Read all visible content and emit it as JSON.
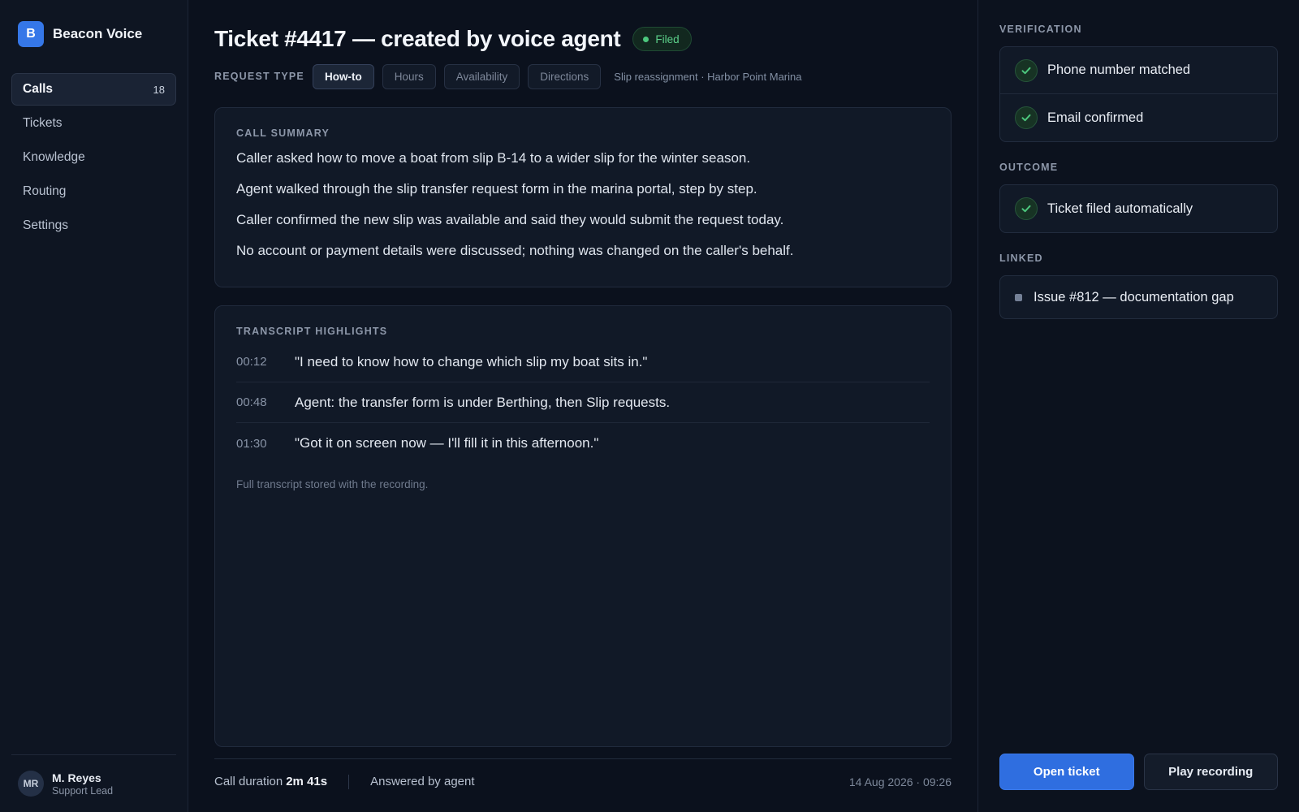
{
  "brand": {
    "logo_letter": "B",
    "name": "Beacon Voice"
  },
  "nav": {
    "items": [
      {
        "label": "Calls",
        "count": "18"
      },
      {
        "label": "Tickets"
      },
      {
        "label": "Knowledge"
      },
      {
        "label": "Routing"
      },
      {
        "label": "Settings"
      }
    ]
  },
  "user": {
    "initials": "MR",
    "name": "M. Reyes",
    "role": "Support Lead"
  },
  "ticket": {
    "title": "Ticket #4417 — created by voice agent",
    "status": "Filed"
  },
  "request_type": {
    "label": "REQUEST TYPE",
    "chips": [
      "How-to",
      "Hours",
      "Availability",
      "Directions"
    ],
    "selected": "How-to",
    "meta": "Slip reassignment · Harbor Point Marina"
  },
  "summary": {
    "label": "CALL SUMMARY",
    "lines": [
      "Caller asked how to move a boat from slip B-14 to a wider slip for the winter season.",
      "Agent walked through the slip transfer request form in the marina portal, step by step.",
      "Caller confirmed the new slip was available and said they would submit the request today.",
      "No account or payment details were discussed; nothing was changed on the caller's behalf."
    ]
  },
  "transcript": {
    "label": "TRANSCRIPT HIGHLIGHTS",
    "rows": [
      {
        "time": "00:12",
        "text": "\"I need to know how to change which slip my boat sits in.\""
      },
      {
        "time": "00:48",
        "text": "Agent: the transfer form is under Berthing, then Slip requests."
      },
      {
        "time": "01:30",
        "text": "\"Got it on screen now — I'll fill it in this afternoon.\""
      }
    ],
    "note": "Full transcript stored with the recording."
  },
  "footer": {
    "duration_label": "Call duration",
    "duration_value": "2m 41s",
    "answered": "Answered by agent",
    "timestamp": "14 Aug 2026 · 09:26"
  },
  "verification": {
    "label": "VERIFICATION",
    "items": [
      "Phone number matched",
      "Email confirmed"
    ]
  },
  "outcome": {
    "label": "OUTCOME",
    "items": [
      "Ticket filed automatically"
    ]
  },
  "linked": {
    "label": "LINKED",
    "items": [
      "Issue #812 — documentation gap"
    ]
  },
  "actions": {
    "open_ticket": "Open ticket",
    "play_recording": "Play recording"
  },
  "colors": {
    "accent": "#2f6ee0",
    "success": "#4cc77d",
    "background": "#0b111d"
  }
}
